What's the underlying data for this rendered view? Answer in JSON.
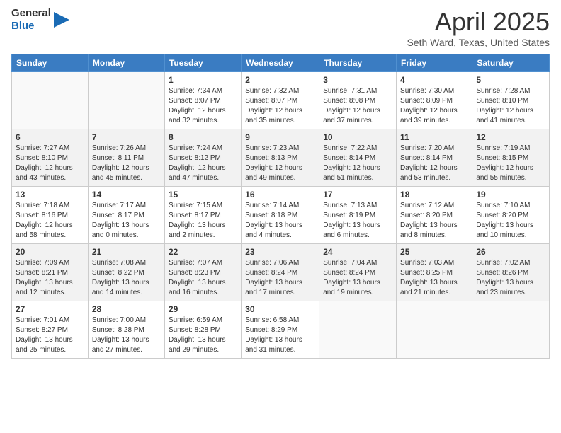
{
  "header": {
    "logo_general": "General",
    "logo_blue": "Blue",
    "title": "April 2025",
    "subtitle": "Seth Ward, Texas, United States"
  },
  "days_of_week": [
    "Sunday",
    "Monday",
    "Tuesday",
    "Wednesday",
    "Thursday",
    "Friday",
    "Saturday"
  ],
  "weeks": [
    [
      {
        "day": "",
        "info": ""
      },
      {
        "day": "",
        "info": ""
      },
      {
        "day": "1",
        "info": "Sunrise: 7:34 AM\nSunset: 8:07 PM\nDaylight: 12 hours and 32 minutes."
      },
      {
        "day": "2",
        "info": "Sunrise: 7:32 AM\nSunset: 8:07 PM\nDaylight: 12 hours and 35 minutes."
      },
      {
        "day": "3",
        "info": "Sunrise: 7:31 AM\nSunset: 8:08 PM\nDaylight: 12 hours and 37 minutes."
      },
      {
        "day": "4",
        "info": "Sunrise: 7:30 AM\nSunset: 8:09 PM\nDaylight: 12 hours and 39 minutes."
      },
      {
        "day": "5",
        "info": "Sunrise: 7:28 AM\nSunset: 8:10 PM\nDaylight: 12 hours and 41 minutes."
      }
    ],
    [
      {
        "day": "6",
        "info": "Sunrise: 7:27 AM\nSunset: 8:10 PM\nDaylight: 12 hours and 43 minutes."
      },
      {
        "day": "7",
        "info": "Sunrise: 7:26 AM\nSunset: 8:11 PM\nDaylight: 12 hours and 45 minutes."
      },
      {
        "day": "8",
        "info": "Sunrise: 7:24 AM\nSunset: 8:12 PM\nDaylight: 12 hours and 47 minutes."
      },
      {
        "day": "9",
        "info": "Sunrise: 7:23 AM\nSunset: 8:13 PM\nDaylight: 12 hours and 49 minutes."
      },
      {
        "day": "10",
        "info": "Sunrise: 7:22 AM\nSunset: 8:14 PM\nDaylight: 12 hours and 51 minutes."
      },
      {
        "day": "11",
        "info": "Sunrise: 7:20 AM\nSunset: 8:14 PM\nDaylight: 12 hours and 53 minutes."
      },
      {
        "day": "12",
        "info": "Sunrise: 7:19 AM\nSunset: 8:15 PM\nDaylight: 12 hours and 55 minutes."
      }
    ],
    [
      {
        "day": "13",
        "info": "Sunrise: 7:18 AM\nSunset: 8:16 PM\nDaylight: 12 hours and 58 minutes."
      },
      {
        "day": "14",
        "info": "Sunrise: 7:17 AM\nSunset: 8:17 PM\nDaylight: 13 hours and 0 minutes."
      },
      {
        "day": "15",
        "info": "Sunrise: 7:15 AM\nSunset: 8:17 PM\nDaylight: 13 hours and 2 minutes."
      },
      {
        "day": "16",
        "info": "Sunrise: 7:14 AM\nSunset: 8:18 PM\nDaylight: 13 hours and 4 minutes."
      },
      {
        "day": "17",
        "info": "Sunrise: 7:13 AM\nSunset: 8:19 PM\nDaylight: 13 hours and 6 minutes."
      },
      {
        "day": "18",
        "info": "Sunrise: 7:12 AM\nSunset: 8:20 PM\nDaylight: 13 hours and 8 minutes."
      },
      {
        "day": "19",
        "info": "Sunrise: 7:10 AM\nSunset: 8:20 PM\nDaylight: 13 hours and 10 minutes."
      }
    ],
    [
      {
        "day": "20",
        "info": "Sunrise: 7:09 AM\nSunset: 8:21 PM\nDaylight: 13 hours and 12 minutes."
      },
      {
        "day": "21",
        "info": "Sunrise: 7:08 AM\nSunset: 8:22 PM\nDaylight: 13 hours and 14 minutes."
      },
      {
        "day": "22",
        "info": "Sunrise: 7:07 AM\nSunset: 8:23 PM\nDaylight: 13 hours and 16 minutes."
      },
      {
        "day": "23",
        "info": "Sunrise: 7:06 AM\nSunset: 8:24 PM\nDaylight: 13 hours and 17 minutes."
      },
      {
        "day": "24",
        "info": "Sunrise: 7:04 AM\nSunset: 8:24 PM\nDaylight: 13 hours and 19 minutes."
      },
      {
        "day": "25",
        "info": "Sunrise: 7:03 AM\nSunset: 8:25 PM\nDaylight: 13 hours and 21 minutes."
      },
      {
        "day": "26",
        "info": "Sunrise: 7:02 AM\nSunset: 8:26 PM\nDaylight: 13 hours and 23 minutes."
      }
    ],
    [
      {
        "day": "27",
        "info": "Sunrise: 7:01 AM\nSunset: 8:27 PM\nDaylight: 13 hours and 25 minutes."
      },
      {
        "day": "28",
        "info": "Sunrise: 7:00 AM\nSunset: 8:28 PM\nDaylight: 13 hours and 27 minutes."
      },
      {
        "day": "29",
        "info": "Sunrise: 6:59 AM\nSunset: 8:28 PM\nDaylight: 13 hours and 29 minutes."
      },
      {
        "day": "30",
        "info": "Sunrise: 6:58 AM\nSunset: 8:29 PM\nDaylight: 13 hours and 31 minutes."
      },
      {
        "day": "",
        "info": ""
      },
      {
        "day": "",
        "info": ""
      },
      {
        "day": "",
        "info": ""
      }
    ]
  ]
}
